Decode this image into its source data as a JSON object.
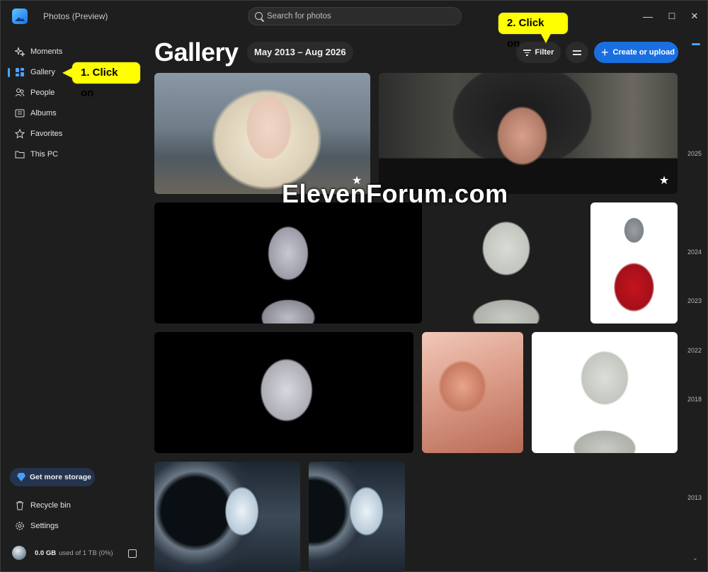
{
  "app": {
    "title": "Photos (Preview)"
  },
  "search": {
    "placeholder": "Search for photos"
  },
  "window_controls": {
    "minimize": "—",
    "maximize": "☐",
    "close": "✕"
  },
  "sidebar": {
    "items": [
      {
        "label": "Moments",
        "icon": "sparkle-icon"
      },
      {
        "label": "Gallery",
        "icon": "gallery-grid-icon",
        "active": true
      },
      {
        "label": "People",
        "icon": "people-icon"
      },
      {
        "label": "Albums",
        "icon": "albums-icon"
      },
      {
        "label": "Favorites",
        "icon": "star-outline-icon"
      },
      {
        "label": "This PC",
        "icon": "folder-icon"
      }
    ],
    "storage_button": "Get more storage",
    "bottom_items": [
      {
        "label": "Recycle bin",
        "icon": "trash-icon"
      },
      {
        "label": "Settings",
        "icon": "gear-icon"
      }
    ],
    "storage": {
      "used": "0.0 GB",
      "total": "used of 1 TB (0%)"
    }
  },
  "header": {
    "title": "Gallery",
    "date_range": "May 2013 – Aug 2026",
    "filter_label": "Filter",
    "create_label": "Create or upload"
  },
  "photos": [
    {
      "id": "p1",
      "favorite": true
    },
    {
      "id": "p2",
      "favorite": true
    },
    {
      "id": "p3",
      "favorite": false
    },
    {
      "id": "p4",
      "favorite": false
    },
    {
      "id": "p5",
      "favorite": false
    },
    {
      "id": "p6",
      "favorite": false
    },
    {
      "id": "p7",
      "favorite": false
    },
    {
      "id": "p8",
      "favorite": false
    },
    {
      "id": "p9",
      "favorite": false
    },
    {
      "id": "p10",
      "favorite": false
    }
  ],
  "timeline": {
    "years": [
      "2025",
      "2024",
      "2023",
      "2022",
      "2018",
      "2013"
    ]
  },
  "watermark": "ElevenForum.com",
  "callouts": {
    "step1": "1. Click on",
    "step2": "2. Click on"
  },
  "colors": {
    "accent": "#1a6fe0",
    "callout": "#ffff00"
  }
}
